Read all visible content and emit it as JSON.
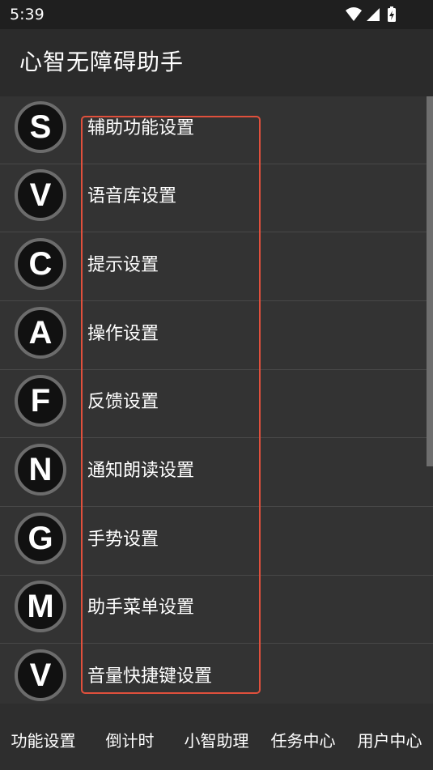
{
  "status_bar": {
    "time": "5:39",
    "icons": [
      "wifi-icon",
      "signal-icon",
      "battery-charging-icon"
    ]
  },
  "app_bar": {
    "title": "心智无障碍助手"
  },
  "settings_list": [
    {
      "letter": "S",
      "label": "辅助功能设置"
    },
    {
      "letter": "V",
      "label": "语音库设置"
    },
    {
      "letter": "C",
      "label": "提示设置"
    },
    {
      "letter": "A",
      "label": "操作设置"
    },
    {
      "letter": "F",
      "label": "反馈设置"
    },
    {
      "letter": "N",
      "label": "通知朗读设置"
    },
    {
      "letter": "G",
      "label": "手势设置"
    },
    {
      "letter": "M",
      "label": "助手菜单设置"
    },
    {
      "letter": "V",
      "label": "音量快捷键设置"
    }
  ],
  "bottom_nav": {
    "tabs": [
      {
        "label": "功能设置"
      },
      {
        "label": "倒计时"
      },
      {
        "label": "小智助理"
      },
      {
        "label": "任务中心"
      },
      {
        "label": "用户中心"
      }
    ]
  },
  "colors": {
    "background": "#333333",
    "app_bar": "#2b2b2b",
    "status_bar": "#1f1f1f",
    "highlight_border": "#e0503c",
    "badge_ring": "#6c6c6c"
  }
}
